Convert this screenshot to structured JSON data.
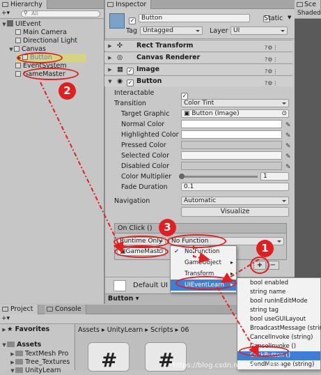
{
  "hierarchy": {
    "tab_label": "Hierarchy",
    "add_label": "+▾",
    "search_placeholder": "All",
    "items": [
      {
        "label": "UIEvent"
      },
      {
        "label": "Main Camera"
      },
      {
        "label": "Directional Light"
      },
      {
        "label": "Canvas"
      },
      {
        "label": "Button"
      },
      {
        "label": "EventSystem"
      },
      {
        "label": "GameMaster"
      }
    ]
  },
  "inspector": {
    "tab_label": "Inspector",
    "object_name": "Button",
    "static_label": "Static",
    "tag_label": "Tag",
    "tag_value": "Untagged",
    "layer_label": "Layer",
    "layer_value": "UI",
    "components": {
      "rect_transform": "Rect Transform",
      "canvas_renderer": "Canvas Renderer",
      "image": "Image",
      "button": "Button"
    },
    "fields": {
      "interactable": "Interactable",
      "transition": "Transition",
      "transition_value": "Color Tint",
      "target_graphic": "Target Graphic",
      "target_graphic_value": "Button (Image)",
      "normal_color": "Normal Color",
      "highlighted_color": "Highlighted Color",
      "pressed_color": "Pressed Color",
      "selected_color": "Selected Color",
      "disabled_color": "Disabled Color",
      "color_multiplier": "Color Multiplier",
      "color_multiplier_value": "1",
      "fade_duration": "Fade Duration",
      "fade_duration_value": "0.1",
      "navigation": "Navigation",
      "navigation_value": "Automatic",
      "visualize": "Visualize"
    },
    "on_click": {
      "header": "On Click ()",
      "runtime": "Runtime Only",
      "function": "No Function",
      "object": "GameMast"
    },
    "default_ui": "Default UI M",
    "bottom_button": "Button"
  },
  "scene": {
    "tab_label": "Sce",
    "shaded": "Shaded"
  },
  "context_menu": {
    "main": [
      {
        "label": "No Function",
        "checked": true
      },
      {
        "label": "GameObject"
      },
      {
        "label": "Transform"
      },
      {
        "label": "UIEventLearn"
      }
    ],
    "submenu": [
      "bool enabled",
      "string name",
      "bool runInEditMode",
      "string tag",
      "bool useGUILayout",
      "BroadcastMessage (string)",
      "CancelInvoke (string)",
      "CancelInvoke ()",
      "ClickButton ()",
      "SendMessage (string)"
    ]
  },
  "project": {
    "tab_project": "Project",
    "tab_console": "Console",
    "add_label": "+▾",
    "favorites": "Favorites",
    "assets": "Assets",
    "tree": [
      "TextMesh Pro",
      "Tree_Textures",
      "UnityLearn"
    ],
    "breadcrumb": [
      "Assets",
      "UnityLearn",
      "Scripts",
      "06"
    ]
  },
  "plus_minus": {
    "plus": "+",
    "minus": "−"
  },
  "badges": [
    "1",
    "2",
    "3"
  ],
  "watermark": "https://blog.csdn.net/m0_...鸣谦",
  "colors": {
    "annotation_red": "#e02020",
    "selection_blue": "#3d7fd6"
  }
}
